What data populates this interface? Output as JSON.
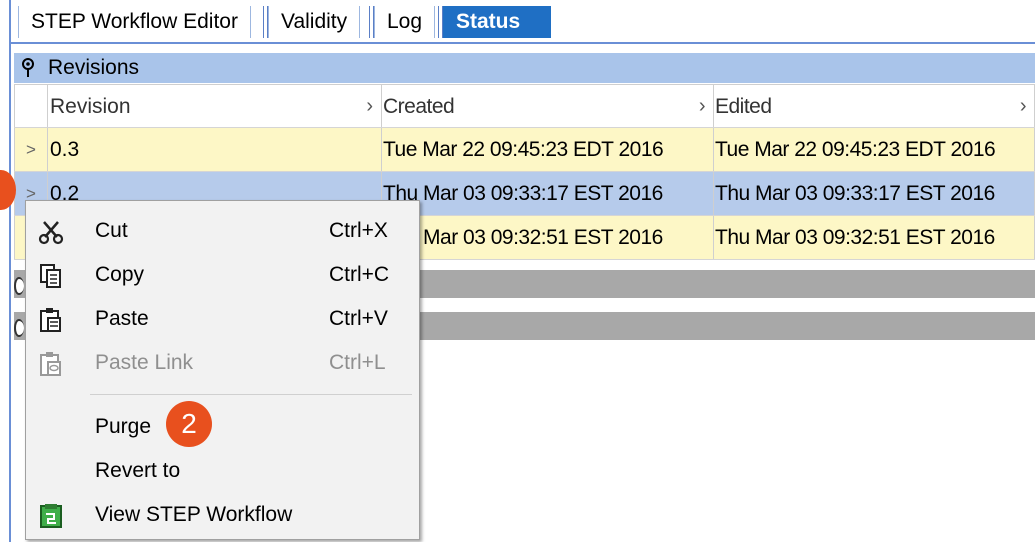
{
  "tabs": [
    {
      "label": "STEP Workflow Editor"
    },
    {
      "label": "Validity"
    },
    {
      "label": "Log"
    },
    {
      "label": "Status",
      "active": true
    }
  ],
  "panel": {
    "title": "Revisions"
  },
  "table": {
    "columns": [
      "Revision",
      "Created",
      "Edited"
    ],
    "rows": [
      {
        "revision": "0.3",
        "created": "Tue Mar 22 09:45:23 EDT 2016",
        "edited": "Tue Mar 22 09:45:23 EDT 2016",
        "highlight": "yellow"
      },
      {
        "revision": "0.2",
        "created": "Thu Mar 03 09:33:17 EST 2016",
        "edited": "Thu Mar 03 09:33:17 EST 2016",
        "highlight": "blue"
      },
      {
        "revision": "",
        "created": "Thu Mar 03 09:32:51 EST 2016",
        "edited": "Thu Mar 03 09:32:51 EST 2016",
        "highlight": "yellow"
      }
    ]
  },
  "context_menu": {
    "items": [
      {
        "label": "Cut",
        "shortcut": "Ctrl+X",
        "icon": "scissors-icon",
        "enabled": true
      },
      {
        "label": "Copy",
        "shortcut": "Ctrl+C",
        "icon": "copy-icon",
        "enabled": true
      },
      {
        "label": "Paste",
        "shortcut": "Ctrl+V",
        "icon": "paste-icon",
        "enabled": true
      },
      {
        "label": "Paste Link",
        "shortcut": "Ctrl+L",
        "icon": "paste-link-icon",
        "enabled": false
      },
      {
        "label": "Purge",
        "shortcut": "",
        "icon": "",
        "enabled": true
      },
      {
        "label": "Revert to",
        "shortcut": "",
        "icon": "",
        "enabled": true
      },
      {
        "label": "View STEP Workflow",
        "shortcut": "",
        "icon": "workflow-icon",
        "enabled": true
      }
    ]
  },
  "callouts": {
    "step2": "2"
  },
  "colors": {
    "active_tab": "#1f6fc4",
    "row_yellow": "#fdf7c6",
    "row_selected": "#b6cbeb",
    "callout": "#e8501e"
  }
}
